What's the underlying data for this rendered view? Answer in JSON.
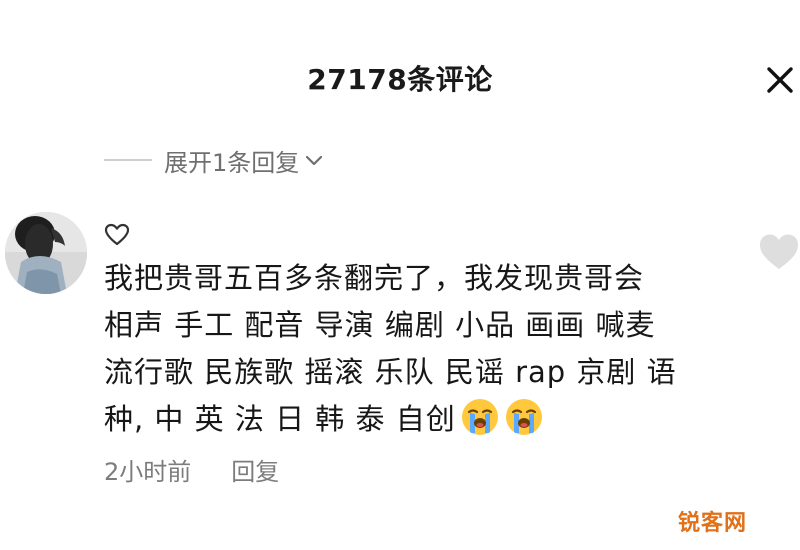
{
  "header": {
    "title": "27178条评论"
  },
  "thread": {
    "expand_label": "展开1条回复"
  },
  "comment": {
    "lines": [
      "我把贵哥五百多条翻完了，我发现贵哥会",
      "相声 手工 配音 导演 编剧 小品 画画 喊麦",
      "流行歌 民族歌 摇滚 乐队 民谣 rap 京剧 语",
      "种, 中 英 法 日 韩 泰 自创"
    ],
    "emojis": [
      "crying-face",
      "crying-face"
    ],
    "time": "2小时前",
    "reply_label": "回复"
  },
  "icons": {
    "close": "close-icon",
    "chevron": "chevron-down-icon",
    "like_small": "heart-outline-icon",
    "like_large": "heart-filled-icon"
  },
  "watermark": {
    "text": "锐客网"
  },
  "colors": {
    "text": "#171717",
    "muted": "#7c7c7c",
    "heart": "#dedede",
    "watermark": "#e0701a"
  }
}
